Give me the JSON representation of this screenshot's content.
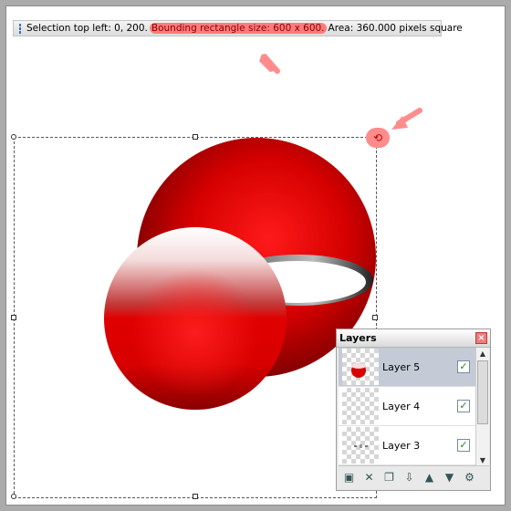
{
  "status": {
    "prefix": "Selection top left: 0, 200.",
    "highlight": "Bounding rectangle size: 600 x 600.",
    "suffix": "Area: 360.000 pixels square"
  },
  "layers_panel": {
    "title": "Layers",
    "close_glyph": "×",
    "layers": [
      {
        "name": "Layer 5",
        "visible_mark": "✓",
        "selected": true
      },
      {
        "name": "Layer 4",
        "visible_mark": "✓",
        "selected": false
      },
      {
        "name": "Layer 3",
        "visible_mark": "✓",
        "selected": false
      }
    ],
    "tool_glyphs": [
      "▣",
      "✕",
      "❐",
      "⇩",
      "▲",
      "▼",
      "⚙"
    ]
  },
  "colors": {
    "accent_highlight": "#ff7b7b",
    "arrow": "#ff8c8c"
  }
}
